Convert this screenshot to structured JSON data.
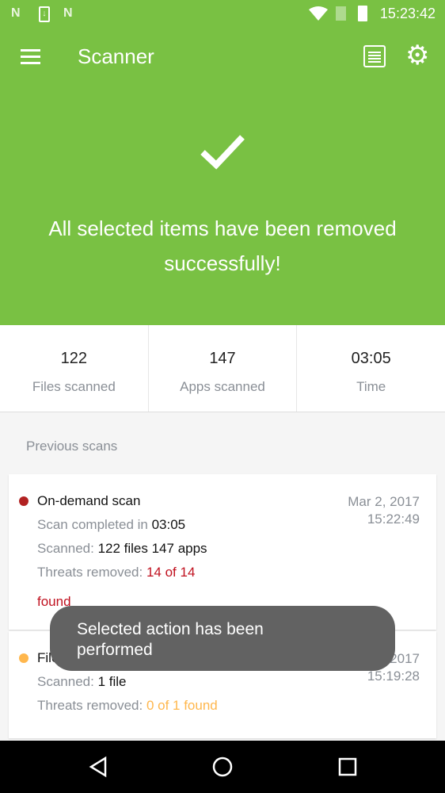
{
  "status_bar": {
    "time": "15:23:42",
    "icons": [
      "n-notification-icon",
      "download-icon",
      "n-notification-icon",
      "wifi-icon",
      "no-sim-icon",
      "battery-charging-icon"
    ]
  },
  "toolbar": {
    "title": "Scanner",
    "icons": [
      "menu-icon",
      "log-list-icon",
      "settings-gear-icon"
    ]
  },
  "result": {
    "message": "All selected items have been removed successfully!"
  },
  "stats": [
    {
      "value": "122",
      "label": "Files scanned"
    },
    {
      "value": "147",
      "label": "Apps scanned"
    },
    {
      "value": "03:05",
      "label": "Time"
    }
  ],
  "previous_scans": {
    "heading": "Previous scans",
    "items": [
      {
        "title": "On-demand scan",
        "dot_color": "#b22222",
        "completed_label": "Scan completed in ",
        "completed_value": "03:05",
        "scanned_label": "Scanned: ",
        "scanned_value": "122 files 147 apps",
        "threats_label": "Threats removed: ",
        "threats_value_1": "14 of 14",
        "threats_value_2": "found",
        "threats_color": "#c0111f",
        "date": "Mar 2, 2017",
        "time": "15:22:49"
      },
      {
        "title": "File monitor",
        "dot_color": "#ffb74d",
        "scanned_label": "Scanned: ",
        "scanned_value": "1 file",
        "threats_label": "Threats removed: ",
        "threats_value": "0 of 1 found",
        "threats_color": "#ffb74d",
        "date": "Mar 2, 2017",
        "time": "15:19:28"
      }
    ]
  },
  "toast": {
    "text": "Selected action has been performed"
  },
  "colors": {
    "primary": "#79c143"
  }
}
